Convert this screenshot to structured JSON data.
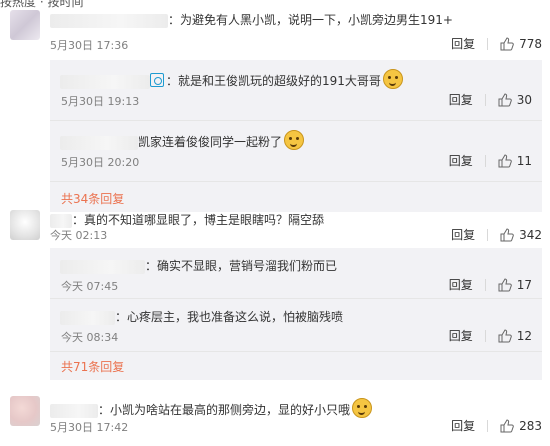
{
  "top_fragment": "按热度 · 按时间",
  "comments": [
    {
      "text": "：为避免有人黑小凯，说明一下，小凯旁边男生191+",
      "time": "5月30日 17:36",
      "reply": "回复",
      "likes": "778",
      "replies": [
        {
          "text": "：就是和王俊凯玩的超级好的191大哥哥",
          "time": "5月30日 19:13",
          "reply": "回复",
          "likes": "30",
          "emoji": "smile-emoji"
        },
        {
          "text": "凯家连着俊俊同学一起粉了",
          "time": "5月30日 20:20",
          "reply": "回复",
          "likes": "11",
          "emoji": "pray-emoji"
        }
      ],
      "more": "共34条回复"
    },
    {
      "text": "：真的不知道哪显眼了，博主是眼瞎吗？隔空舔",
      "time": "今天 02:13",
      "reply": "回复",
      "likes": "342",
      "replies": [
        {
          "text": "：确实不显眼，营销号溜我们粉而已",
          "time": "今天 07:45",
          "reply": "回复",
          "likes": "17"
        },
        {
          "text": "：心疼层主，我也准备这么说，怕被脑残喷",
          "time": "今天 08:34",
          "reply": "回复",
          "likes": "12"
        }
      ],
      "more": "共71条回复"
    },
    {
      "text": "：小凯为啥站在最高的那侧旁边，显的好小只哦",
      "time": "5月30日 17:42",
      "reply": "回复",
      "likes": "283",
      "emoji": "laugh-emoji"
    }
  ],
  "colors": {
    "link": "#eb7350",
    "meta": "#808080",
    "subbox": "#f2f2f5"
  }
}
